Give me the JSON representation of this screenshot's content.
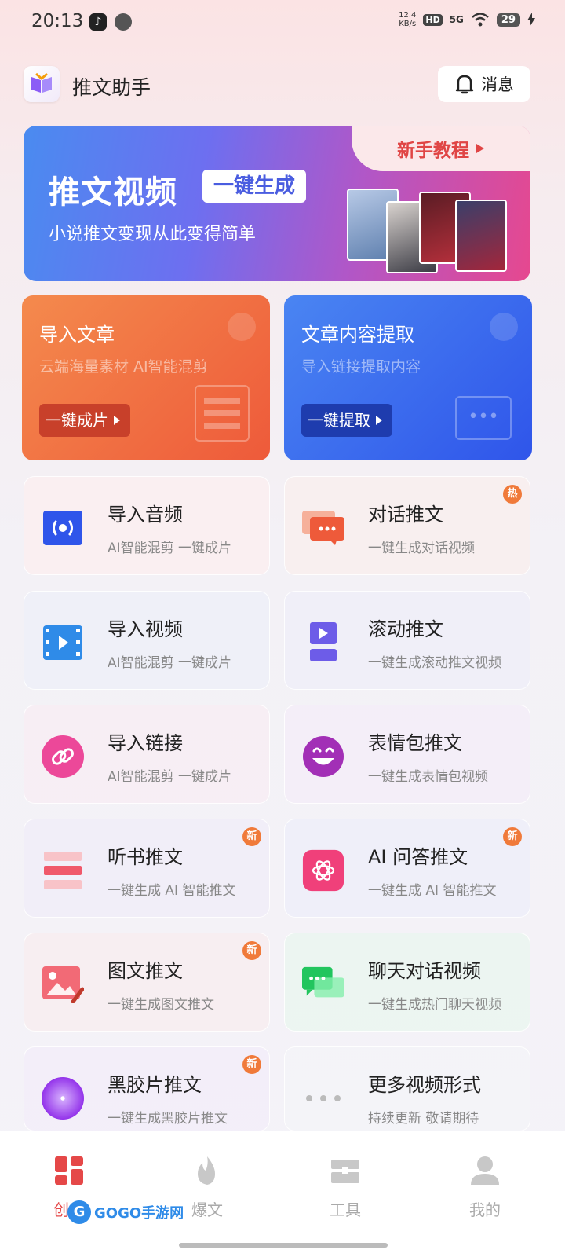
{
  "status_bar": {
    "time": "20:13",
    "net_speed_top": "12.4",
    "net_speed_bottom": "KB/s",
    "hd": "HD",
    "network": "5G",
    "battery": "29"
  },
  "header": {
    "title": "推文助手",
    "messages_label": "消息"
  },
  "banner": {
    "tag": "新手教程",
    "title": "推文视频",
    "badge": "一键生成",
    "subtitle": "小说推文变现从此变得简单"
  },
  "big_cards": [
    {
      "title": "导入文章",
      "subtitle": "云端海量素材 AI智能混剪",
      "button": "一键成片"
    },
    {
      "title": "文章内容提取",
      "subtitle": "导入链接提取内容",
      "button": "一键提取"
    }
  ],
  "features": [
    {
      "title": "导入音频",
      "subtitle": "AI智能混剪 一键成片",
      "badge": ""
    },
    {
      "title": "对话推文",
      "subtitle": "一键生成对话视频",
      "badge": "热"
    },
    {
      "title": "导入视频",
      "subtitle": "AI智能混剪 一键成片",
      "badge": ""
    },
    {
      "title": "滚动推文",
      "subtitle": "一键生成滚动推文视频",
      "badge": ""
    },
    {
      "title": "导入链接",
      "subtitle": "AI智能混剪 一键成片",
      "badge": ""
    },
    {
      "title": "表情包推文",
      "subtitle": "一键生成表情包视频",
      "badge": ""
    },
    {
      "title": "听书推文",
      "subtitle": "一键生成 AI 智能推文",
      "badge": "新"
    },
    {
      "title": "AI 问答推文",
      "subtitle": "一键生成 AI 智能推文",
      "badge": "新"
    },
    {
      "title": "图文推文",
      "subtitle": "一键生成图文推文",
      "badge": "新"
    },
    {
      "title": "聊天对话视频",
      "subtitle": "一键生成热门聊天视频",
      "badge": ""
    },
    {
      "title": "黑胶片推文",
      "subtitle": "一键生成黑胶片推文",
      "badge": "新"
    },
    {
      "title": "更多视频形式",
      "subtitle": "持续更新 敬请期待",
      "badge": ""
    }
  ],
  "bottom_nav": [
    {
      "label": "创作",
      "active": true
    },
    {
      "label": "爆文",
      "active": false
    },
    {
      "label": "工具",
      "active": false
    },
    {
      "label": "我的",
      "active": false
    }
  ],
  "watermark": {
    "text": "GOGO手游网"
  },
  "colors": {
    "accent_red": "#e54848",
    "badge_orange": "#f07a3a",
    "banner_start": "#4a8bf0",
    "banner_end": "#e6488f"
  }
}
